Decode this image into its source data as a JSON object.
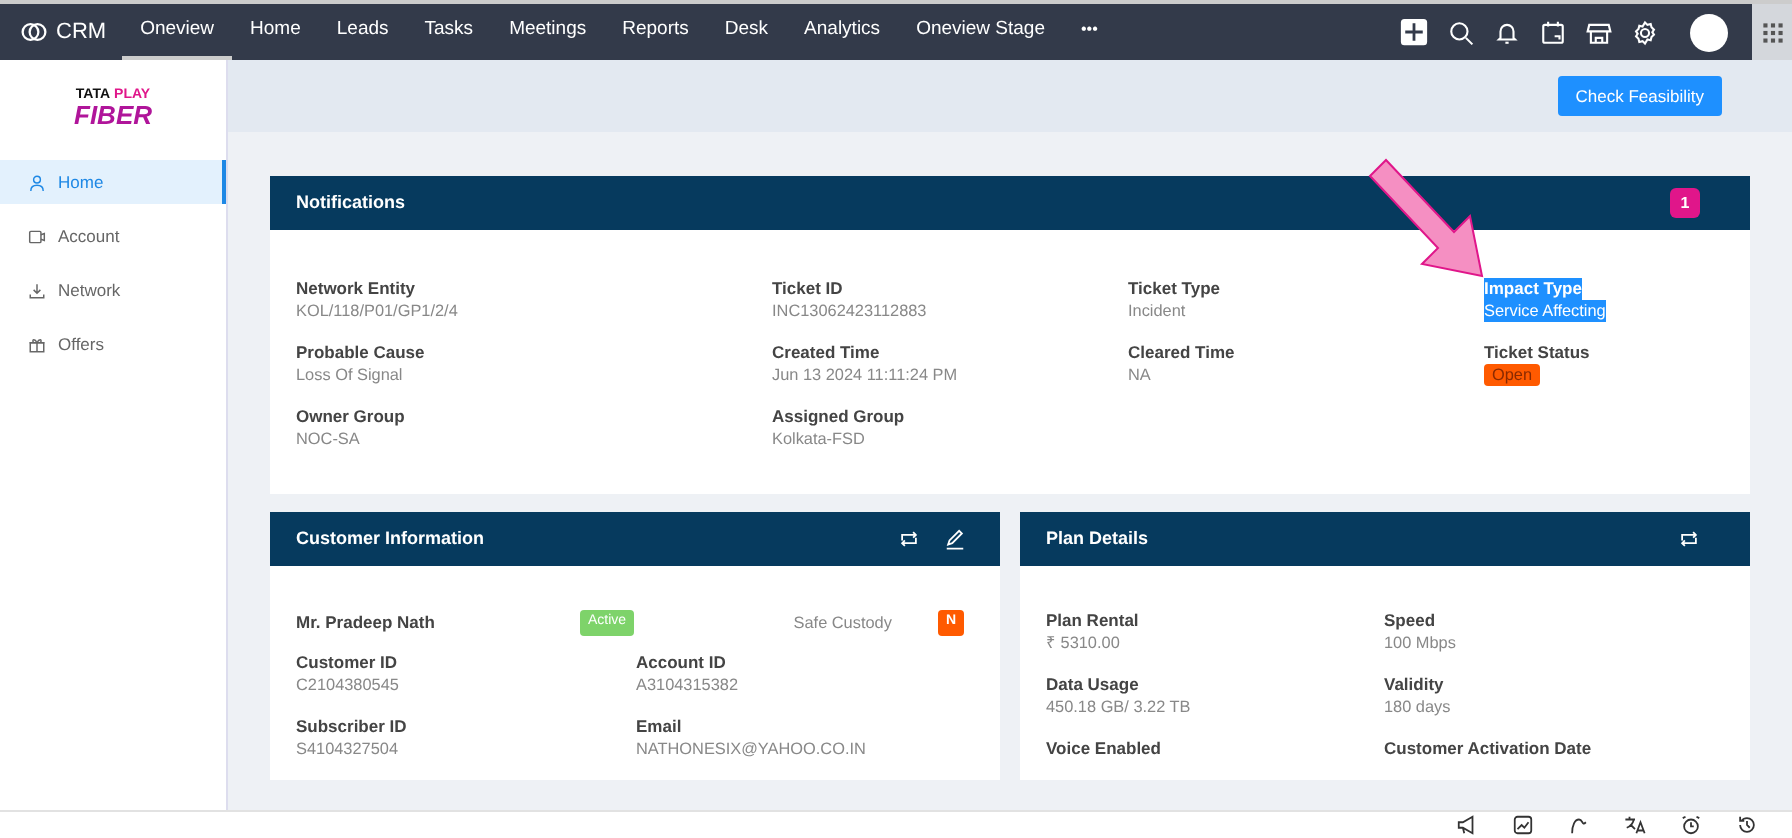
{
  "topbar": {
    "app_name": "CRM",
    "tabs": [
      {
        "label": "Oneview",
        "selected": true
      },
      {
        "label": "Home",
        "selected": false
      },
      {
        "label": "Leads",
        "selected": false
      },
      {
        "label": "Tasks",
        "selected": false
      },
      {
        "label": "Meetings",
        "selected": false
      },
      {
        "label": "Reports",
        "selected": false
      },
      {
        "label": "Desk",
        "selected": false
      },
      {
        "label": "Analytics",
        "selected": false
      },
      {
        "label": "Oneview Stage",
        "selected": false
      }
    ],
    "more": "•••"
  },
  "sidebar": {
    "logo_top": [
      "TATA",
      "PLAY"
    ],
    "logo_bottom": "FIBER",
    "items": [
      {
        "label": "Home",
        "selected": true
      },
      {
        "label": "Account",
        "selected": false
      },
      {
        "label": "Network",
        "selected": false
      },
      {
        "label": "Offers",
        "selected": false
      }
    ]
  },
  "action_button": "Check Feasibility",
  "notifications": {
    "title": "Notifications",
    "count": "1",
    "fields": [
      {
        "label": "Network Entity",
        "value": "KOL/118/P01/GP1/2/4",
        "kind": "text",
        "highlighted": false
      },
      {
        "label": "Ticket ID",
        "value": "INC13062423112883",
        "kind": "text",
        "highlighted": false
      },
      {
        "label": "Ticket Type",
        "value": "Incident",
        "kind": "text",
        "highlighted": false
      },
      {
        "label": "Impact Type",
        "value": "Service Affecting",
        "kind": "text",
        "highlighted": true
      },
      {
        "label": "Probable Cause",
        "value": "Loss Of Signal",
        "kind": "text",
        "highlighted": false
      },
      {
        "label": "Created Time",
        "value": "Jun 13 2024 11:11:24 PM",
        "kind": "text",
        "highlighted": false
      },
      {
        "label": "Cleared Time",
        "value": "NA",
        "kind": "text",
        "highlighted": false
      },
      {
        "label": "Ticket Status",
        "value": "Open",
        "kind": "badge",
        "highlighted": false
      },
      {
        "label": "Owner Group",
        "value": "NOC-SA",
        "kind": "text",
        "highlighted": false
      },
      {
        "label": "Assigned Group",
        "value": "Kolkata-FSD",
        "kind": "text",
        "highlighted": false
      }
    ]
  },
  "customer_information": {
    "title": "Customer Information",
    "name": "Mr. Pradeep Nath",
    "status": "Active",
    "safe_custody_label": "Safe Custody",
    "safe_custody": "N",
    "fields": [
      {
        "label": "Customer ID",
        "value": "C2104380545"
      },
      {
        "label": "Account ID",
        "value": "A3104315382"
      },
      {
        "label": "Subscriber ID",
        "value": "S4104327504"
      },
      {
        "label": "Email",
        "value": "NATHONESIX@YAHOO.CO.IN"
      }
    ]
  },
  "plan_details": {
    "title": "Plan Details",
    "fields": [
      {
        "label": "Plan Rental",
        "value": "₹ 5310.00"
      },
      {
        "label": "Speed",
        "value": "100 Mbps"
      },
      {
        "label": "Data Usage",
        "value": "450.18 GB/ 3.22 TB"
      },
      {
        "label": "Validity",
        "value": "180 days"
      },
      {
        "label": "Voice Enabled"
      },
      {
        "label": "Customer Activation Date"
      }
    ]
  }
}
